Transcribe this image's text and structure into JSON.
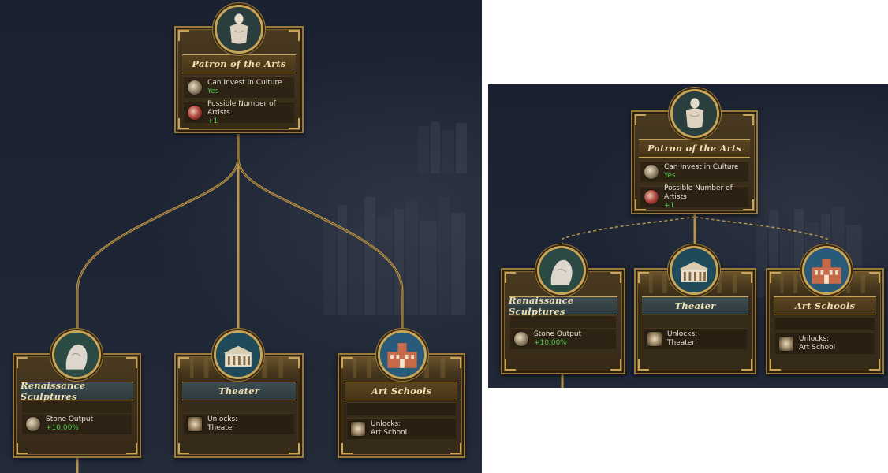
{
  "colors": {
    "accent_gold": "#c9a55a",
    "positive_green": "#4ec74e",
    "title_text": "#f0dfb0"
  },
  "left": {
    "root": {
      "title": "Patron of the Arts",
      "icon": "statue-icon",
      "rows": [
        {
          "label": "Can Invest in Culture",
          "value": "Yes",
          "icon": "coins-icon"
        },
        {
          "label": "Possible Number of Artists",
          "value": "+1",
          "icon": "artist-icon"
        }
      ]
    },
    "children": [
      {
        "title": "Renaissance Sculptures",
        "icon": "sculpture-icon",
        "row_label": "Stone Output",
        "row_value": "+10.00%",
        "row_icon": "stone-icon"
      },
      {
        "title": "Theater",
        "icon": "theater-icon",
        "row_label": "Unlocks:",
        "row_value": "Theater",
        "row_icon": "building-icon"
      },
      {
        "title": "Art Schools",
        "icon": "art-school-icon",
        "row_label": "Unlocks:",
        "row_value": "Art School",
        "row_icon": "building-icon"
      }
    ]
  },
  "right": {
    "root": {
      "title": "Patron of the Arts",
      "rows": [
        {
          "label": "Can Invest in Culture",
          "value": "Yes"
        },
        {
          "label": "Possible Number of Artists",
          "value": "+1"
        }
      ]
    },
    "children": [
      {
        "title": "Renaissance Sculptures",
        "row_label": "Stone Output",
        "row_value": "+10.00%"
      },
      {
        "title": "Theater",
        "row_label": "Unlocks:",
        "row_value": "Theater"
      },
      {
        "title": "Art Schools",
        "row_label": "Unlocks:",
        "row_value": "Art School"
      }
    ]
  }
}
